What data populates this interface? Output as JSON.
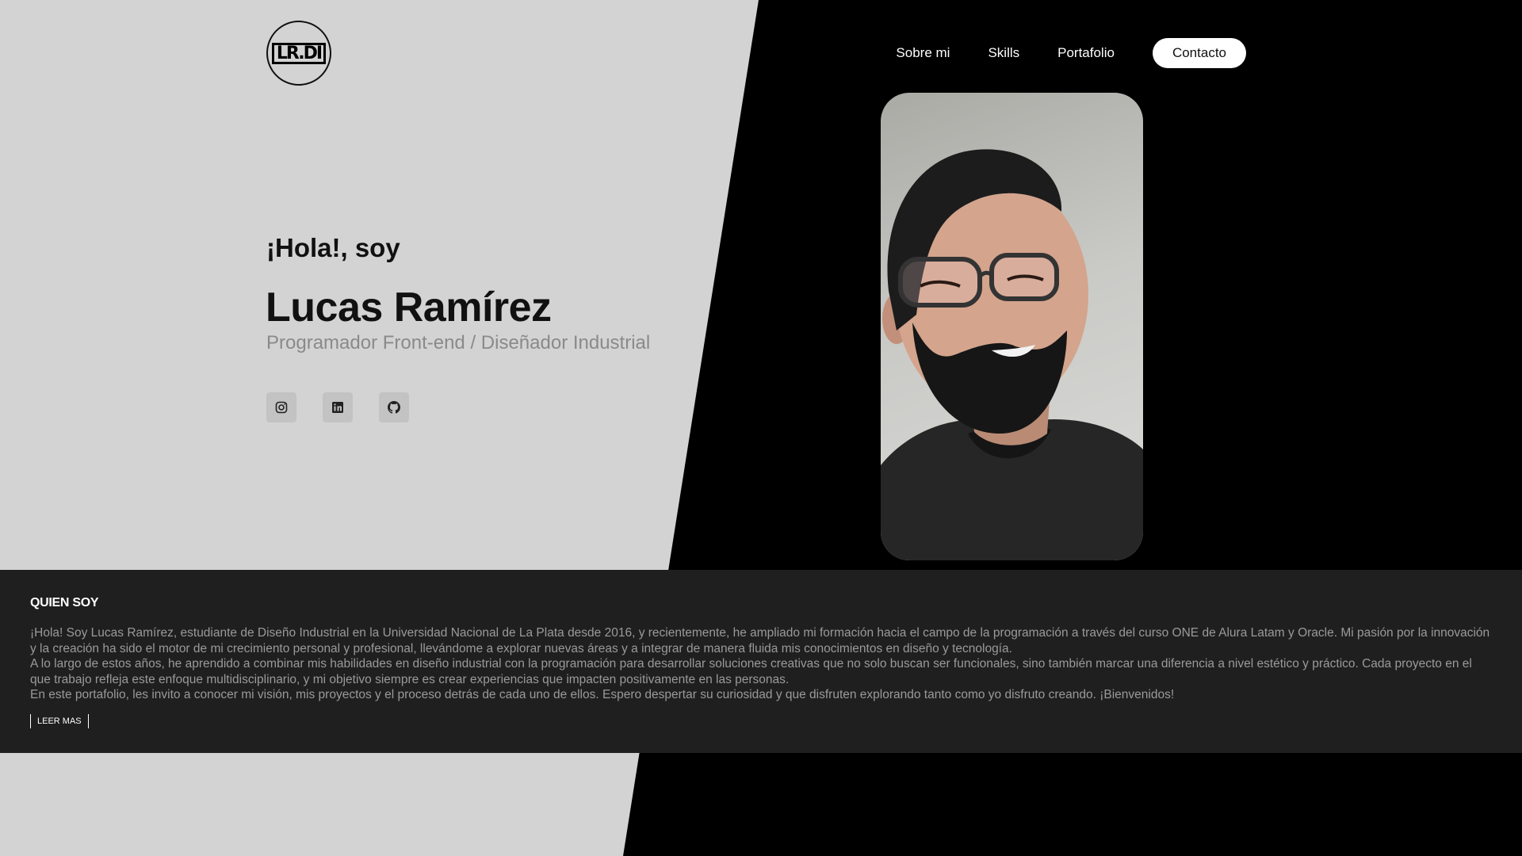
{
  "header": {
    "logo_text": "LR.DI",
    "nav": [
      "Sobre mi",
      "Skills",
      "Portafolio"
    ],
    "contact_label": "Contacto"
  },
  "hero": {
    "greeting": "¡Hola!, soy",
    "name": "Lucas Ramírez",
    "role": "Programador Front-end / Diseñador Industrial",
    "socials": [
      "instagram-icon",
      "linkedin-icon",
      "github-icon"
    ],
    "photo_alt": "Lucas Ramírez"
  },
  "about": {
    "title": "QUIEN SOY",
    "paragraphs": [
      "¡Hola! Soy Lucas Ramírez, estudiante de Diseño Industrial en la Universidad Nacional de La Plata desde 2016, y recientemente, he ampliado mi formación hacia el campo de la programación a través del curso ONE de Alura Latam y Oracle. Mi pasión por la innovación y la creación ha sido el motor de mi crecimiento personal y profesional, llevándome a explorar nuevas áreas y a integrar de manera fluida mis conocimientos en diseño y tecnología.",
      "A lo largo de estos años, he aprendido a combinar mis habilidades en diseño industrial con la programación para desarrollar soluciones creativas que no solo buscan ser funcionales, sino también marcar una diferencia a nivel estético y práctico. Cada proyecto en el que trabajo refleja este enfoque multidisciplinario, y mi objetivo siempre es crear experiencias que impacten positivamente en las personas.",
      "En este portafolio, les invito a conocer mi visión, mis proyectos y el proceso detrás de cada uno de ellos. Espero despertar su curiosidad y que disfruten explorando tanto como yo disfruto creando. ¡Bienvenidos!"
    ],
    "read_more": "LEER MAS"
  },
  "colors": {
    "light_panel": "#d3d3d3",
    "dark_panel": "#000000",
    "about_bg": "#1f1f1f"
  }
}
